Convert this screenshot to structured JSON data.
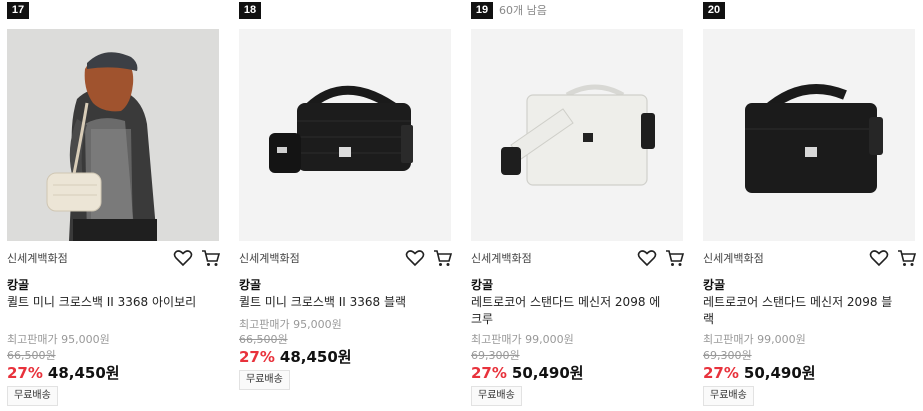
{
  "products": [
    {
      "rank": "17",
      "stock": "",
      "store": "신세계백화점",
      "brand": "캉골",
      "name": "퀼트 미니 크로스백 II 3368 아이보리",
      "max_price": "최고판매가 95,000원",
      "original": "66,500원",
      "discount": "27%",
      "price": "48,450원",
      "badge": "무료배송",
      "image_desc": "model-ivory-bag"
    },
    {
      "rank": "18",
      "stock": "",
      "store": "신세계백화점",
      "brand": "캉골",
      "name": "퀼트 미니 크로스백 II 3368 블랙",
      "max_price": "최고판매가 95,000원",
      "original": "66,500원",
      "discount": "27%",
      "price": "48,450원",
      "badge": "무료배송",
      "image_desc": "black-crossbag"
    },
    {
      "rank": "19",
      "stock": "60개 남음",
      "store": "신세계백화점",
      "brand": "캉골",
      "name": "레트로코어 스탠다드 메신저 2098 에크루",
      "max_price": "최고판매가 99,000원",
      "original": "69,300원",
      "discount": "27%",
      "price": "50,490원",
      "badge": "무료배송",
      "image_desc": "ecru-messenger"
    },
    {
      "rank": "20",
      "stock": "",
      "store": "신세계백화점",
      "brand": "캉골",
      "name": "레트로코어 스탠다드 메신저 2098 블랙",
      "max_price": "최고판매가 99,000원",
      "original": "69,300원",
      "discount": "27%",
      "price": "50,490원",
      "badge": "무료배송",
      "image_desc": "black-messenger"
    }
  ],
  "icons": {
    "wishlist": "heart-icon",
    "cart": "cart-icon"
  },
  "colors": {
    "discount": "#e8323c",
    "rank_bg": "#111111"
  }
}
